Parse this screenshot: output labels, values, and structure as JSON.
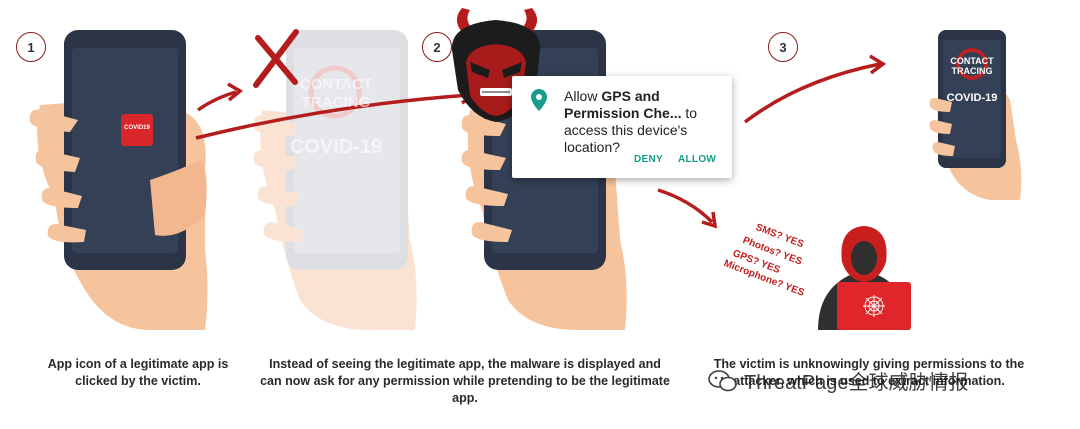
{
  "steps": [
    {
      "number": "1",
      "caption": "App icon of a legitimate app is clicked by the victim."
    },
    {
      "number": "2",
      "caption": "Instead of seeing the legitimate app, the malware is displayed and can now ask for any permission while pretending to be the legitimate app."
    },
    {
      "number": "3",
      "caption": "The victim is unknowingly giving permissions to the attacker, which is used to extract information."
    }
  ],
  "app_icon_label": "COVID19",
  "fake_app": {
    "logo_line1": "CONTACT",
    "logo_line2": "TRACING",
    "title": "COVID-19"
  },
  "permission_dialog": {
    "prefix": "Allow ",
    "app_name": "GPS and Permission Che...",
    "suffix": " to access this device's location?",
    "deny_label": "DENY",
    "allow_label": "ALLOW"
  },
  "permissions_granted": [
    "SMS? YES",
    "Photos? YES",
    "GPS? YES",
    "Microphone? YES"
  ],
  "watermark": "ThreatPage全球威胁情报",
  "colors": {
    "accent_red": "#b51d1d",
    "phone_dark": "#2b3547",
    "skin": "#f5c39c",
    "teal": "#1a9c8a"
  }
}
